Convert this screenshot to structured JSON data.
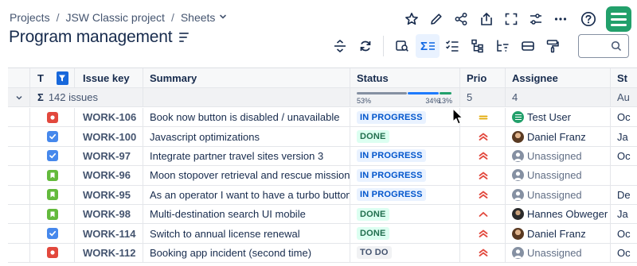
{
  "breadcrumb": {
    "items": [
      "Projects",
      "JSW Classic project",
      "Sheets"
    ]
  },
  "page": {
    "title": "Program management"
  },
  "search": {
    "value": ""
  },
  "columns": {
    "type": "T",
    "key": "Issue key",
    "summary": "Summary",
    "status": "Status",
    "priority": "Prio",
    "assignee": "Assignee",
    "extra": "St"
  },
  "summary_row": {
    "sigma": "Σ",
    "issues": "142 issues",
    "status_pcts": [
      "53%",
      "34%",
      "13%"
    ],
    "status_fractions": [
      0.53,
      0.34,
      0.13
    ],
    "status_colors": [
      "#8590a2",
      "#1d7afc",
      "#22a06b"
    ],
    "priority_count": "5",
    "assignee_count": "4",
    "extra": "Au"
  },
  "rows": [
    {
      "type": "bug",
      "key": "WORK-106",
      "summary": "Book now button is disabled / unavailable",
      "status": "IN PROGRESS",
      "status_kind": "inprogress",
      "priority": "medium",
      "assignee": "Test User",
      "avatar": "green-logo",
      "extra": "Oc"
    },
    {
      "type": "task",
      "key": "WORK-100",
      "summary": "Javascript optimizations",
      "status": "DONE",
      "status_kind": "done",
      "priority": "high",
      "assignee": "Daniel Franz",
      "avatar": "photo-brown",
      "extra": "Ja"
    },
    {
      "type": "task",
      "key": "WORK-97",
      "summary": "Integrate partner travel sites version 3",
      "status": "IN PROGRESS",
      "status_kind": "inprogress",
      "priority": "high",
      "assignee": "Unassigned",
      "avatar": "unassigned",
      "extra": "Oc"
    },
    {
      "type": "story",
      "key": "WORK-96",
      "summary": "Moon stopover retrieval and rescue mission ...",
      "status": "IN PROGRESS",
      "status_kind": "inprogress",
      "priority": "high",
      "assignee": "Unassigned",
      "avatar": "unassigned",
      "extra": ""
    },
    {
      "type": "story",
      "key": "WORK-95",
      "summary": "As an operator I want to have a turbo button",
      "status": "IN PROGRESS",
      "status_kind": "inprogress",
      "priority": "high",
      "assignee": "Unassigned",
      "avatar": "unassigned",
      "extra": "De"
    },
    {
      "type": "story",
      "key": "WORK-98",
      "summary": "Multi-destination search UI mobile",
      "status": "DONE",
      "status_kind": "done",
      "priority": "low-up",
      "assignee": "Hannes Obweger",
      "avatar": "photo-dark",
      "extra": "Ja"
    },
    {
      "type": "task",
      "key": "WORK-114",
      "summary": "Switch to annual license renewal",
      "status": "DONE",
      "status_kind": "done",
      "priority": "high",
      "assignee": "Daniel Franz",
      "avatar": "photo-brown",
      "extra": "Oc"
    },
    {
      "type": "bug",
      "key": "WORK-112",
      "summary": "Booking app incident (second time)",
      "status": "TO DO",
      "status_kind": "todo",
      "priority": "high",
      "assignee": "Unassigned",
      "avatar": "unassigned",
      "extra": "Oc"
    }
  ],
  "colors": {
    "accent": "#1868db",
    "priority_high": "#e2483d",
    "priority_medium": "#e2a800"
  },
  "icons": {
    "top": [
      "star-icon",
      "edit-icon",
      "share-icon",
      "export-icon",
      "fullscreen-icon",
      "settings-sliders-icon",
      "more-icon",
      "help-icon"
    ],
    "toolbar": [
      "expand-collapse-icon",
      "refresh-icon",
      "issue-search-icon",
      "sum-icon",
      "checklist-icon",
      "hierarchy-icon",
      "hierarchy-filter-icon",
      "card-icon",
      "paint-roller-icon"
    ]
  }
}
